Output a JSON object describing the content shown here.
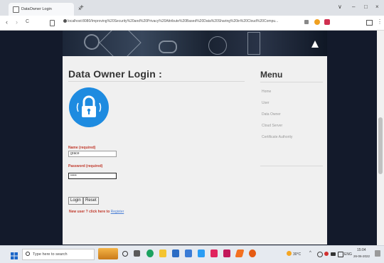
{
  "browser": {
    "tab_title": "DataOwner Login",
    "tab_close": "×",
    "new_tab": "+",
    "url": "localhost:8080/Improving%20Security%20and%20Privacy%20Attribute%20Based%20Data%20Sharing%20in%20Cloud%20Compu...",
    "back": "‹",
    "forward": "›",
    "reload": "C",
    "minimize": "∨",
    "restore": "–",
    "maximize": "□",
    "close": "×"
  },
  "page": {
    "title": "Data Owner Login :",
    "name_label": "Name (required)",
    "name_value": "grace",
    "password_label": "Password (required)",
    "password_value": "•••••",
    "login_button": "Login",
    "reset_button": "Reset",
    "new_user_text": "New user ? click here to",
    "register_link": "Register"
  },
  "menu": {
    "heading": "Menu",
    "items": [
      "Home",
      "User",
      "Data Owner",
      "Cloud Server",
      "Certificate Authority"
    ]
  },
  "taskbar": {
    "search_placeholder": "Type here to search",
    "temperature": "30°C",
    "language": "ENG",
    "time": "15:04",
    "date": "26-06-2022"
  },
  "colors": {
    "accent_blue": "#1e8be0",
    "label_red": "#c0392b",
    "page_dark": "#131a2b"
  }
}
